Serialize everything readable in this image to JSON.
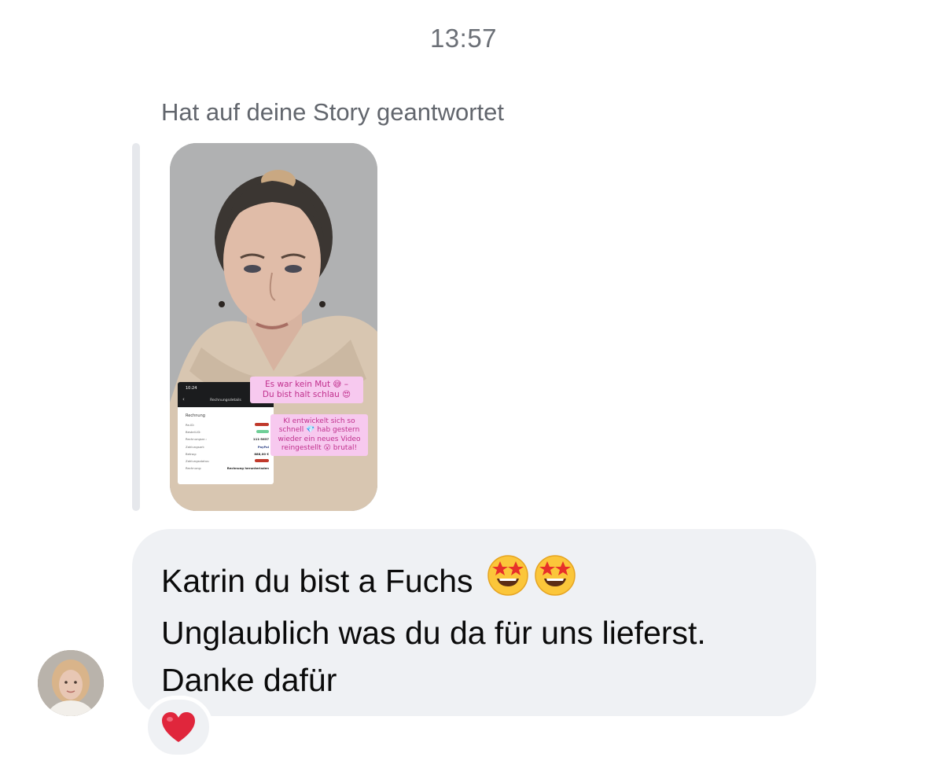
{
  "timestamp": "13:57",
  "story_reply": {
    "label": "Hat auf deine Story geantwortet",
    "thumbnail": {
      "sticker_1": "Es war kein Mut 😅 –\nDu bist halt schlau 😍",
      "sticker_2": "KI entwickelt sich so\nschnell 💎 hab gestern\nwieder ein neues Video\nreingestellt 😮 brutal!",
      "screenshot": {
        "clock": "10:24",
        "title": "Rechnungsdetails",
        "heading": "Rechnung",
        "rows": [
          {
            "label": "Re-ID:"
          },
          {
            "label": "Bestell-ID:"
          },
          {
            "label": "Rechnungsnr.:",
            "value": "111-5637"
          },
          {
            "label": "Zahlungsart:",
            "value": "PayPal"
          },
          {
            "label": "Betrag:",
            "value": "888,00 €"
          },
          {
            "label": "Zahlungsstatus:"
          },
          {
            "label": "Rechnung:",
            "value": "Rechnung herunterladen"
          }
        ]
      }
    }
  },
  "message": {
    "line1": "Katrin du bist a Fuchs",
    "line1_emojis": [
      "star-struck",
      "star-struck"
    ],
    "line2": "Unglaublich was du da für uns lieferst.",
    "line3": "Danke dafür"
  },
  "reaction": {
    "emoji": "red-heart",
    "color": "#e0263c"
  },
  "colors": {
    "bubble": "#eff1f4",
    "meta_text": "#6b6f76",
    "sticker_bg": "#f7c9ef",
    "sticker_text": "#c0308d"
  }
}
